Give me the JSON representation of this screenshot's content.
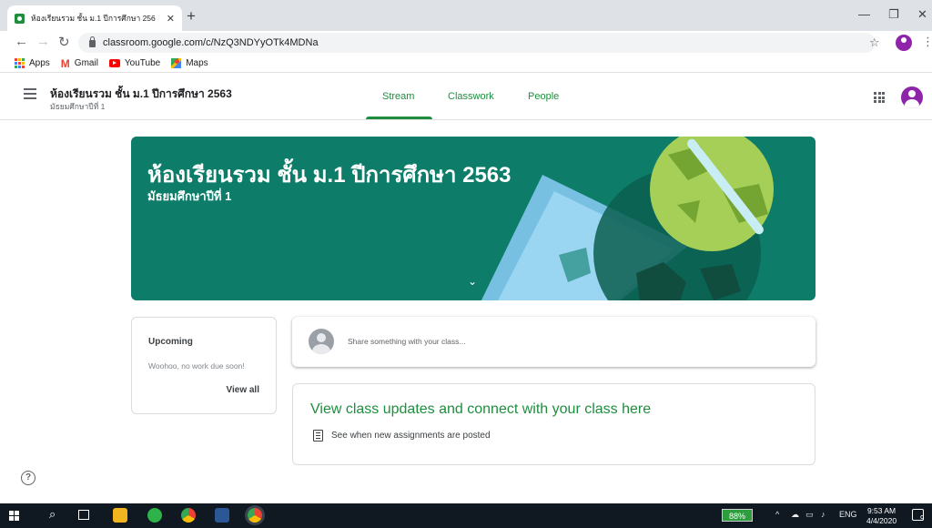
{
  "browser": {
    "tab_title": "ห้องเรียนรวม ชั้น ม.1 ปีการศึกษา 256",
    "tab_close": "✕",
    "new_tab": "+",
    "window_controls": [
      "—",
      "❐",
      "✕"
    ],
    "url": "classroom.google.com/c/NzQ3NDYyOTk4MDNa",
    "bookmarks": [
      {
        "label": "Apps",
        "icon": "apps-grid-icon"
      },
      {
        "label": "Gmail",
        "icon": "gmail-icon"
      },
      {
        "label": "YouTube",
        "icon": "youtube-icon"
      },
      {
        "label": "Maps",
        "icon": "maps-icon"
      }
    ]
  },
  "classroom": {
    "class_name": "ห้องเรียนรวม ชั้น ม.1 ปีการศึกษา 2563",
    "section": "มัธยมศึกษาปีที่ 1",
    "tabs": [
      {
        "label": "Stream",
        "active": true
      },
      {
        "label": "Classwork",
        "active": false
      },
      {
        "label": "People",
        "active": false
      }
    ],
    "banner": {
      "title": "ห้องเรียนรวม ชั้น ม.1 ปีการศึกษา 2563",
      "subtitle": "มัธยมศึกษาปีที่ 1",
      "color": "#0d7d69"
    },
    "upcoming": {
      "title": "Upcoming",
      "message": "Woohoo, no work due soon!",
      "view_all": "View all"
    },
    "share_placeholder": "Share something with your class...",
    "updates": {
      "title": "View class updates and connect with your class here",
      "line": "See when new assignments are posted"
    },
    "help": "?",
    "accent": "#1e8e3e"
  },
  "taskbar": {
    "battery": "88%",
    "lang": "ENG",
    "time": "9:53 AM",
    "date": "4/4/2020",
    "notifications": "9"
  }
}
